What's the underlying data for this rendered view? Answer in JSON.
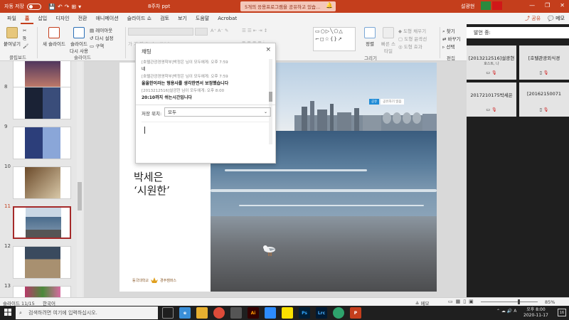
{
  "titlebar": {
    "autosave": "자동 저장",
    "autosave_state": "",
    "doc_title": "8주차 ppt",
    "share_banner": "5개의 응용프로그램을 공유하고 있습...",
    "user": "설광현",
    "controls": [
      "—",
      "❐",
      "✕"
    ]
  },
  "tabs": {
    "items": [
      "파일",
      "홈",
      "삽입",
      "디자인",
      "전환",
      "애니메이션",
      "슬라이드 쇼",
      "검토",
      "보기",
      "도움말",
      "Acrobat"
    ],
    "active_index": 1,
    "share": "공유",
    "memo": "메모"
  },
  "ribbon": {
    "clipboard": {
      "paste": "붙여넣기",
      "label": "클립보드"
    },
    "slides": {
      "new_slide": "새 슬라이드",
      "reuse": "슬라이드 다시 사용",
      "layout": "레이아웃",
      "reset": "다시 설정",
      "section": "구역",
      "label": "슬라이드"
    },
    "drawing": {
      "arrange": "정렬",
      "quick_styles": "빠른 스타일",
      "fill": "도형 채우기",
      "outline": "도형 윤곽선",
      "effects": "도형 효과",
      "label": "그리기"
    },
    "editing": {
      "find": "찾기",
      "replace": "바꾸기",
      "select": "선택",
      "label": "편집"
    }
  },
  "thumbnails": [
    {
      "num": "8"
    },
    {
      "num": "9"
    },
    {
      "num": "10"
    },
    {
      "num": "11",
      "active": true
    },
    {
      "num": "12"
    },
    {
      "num": "13"
    }
  ],
  "chat": {
    "title": "채팅",
    "messages": [
      {
        "meta": "[호텔관광경영학부]박정은 님이 모두에게:     오후 7:59",
        "text": "네"
      },
      {
        "meta": "[호텔관광경영학부]박정은 님이 모두에게:     오후 7:59",
        "text": "울올한이라는 형용사를 생각한면서 보정했습니다"
      },
      {
        "meta": "[2013212516]설광현 님이 모두에게:     오후 8:00",
        "text": "20:10까지 쉬는시간입니다"
      }
    ],
    "save_label": "저장 위치:",
    "save_value": "모두"
  },
  "slide": {
    "title_line1": "박세은",
    "title_line2": "‘시원한’",
    "logo_text": "동국대학교",
    "logo_campus": "경주캠퍼스",
    "chip1": "공유",
    "chip2": "공유하기 일음"
  },
  "attendees": {
    "header": "발언 중:",
    "cards": [
      {
        "name": "[2013212516]설광현",
        "sub": "호스트, 나"
      },
      {
        "name": "[호텔관광외식경",
        "sub": ""
      },
      {
        "name": "2017210175박세은",
        "sub": ""
      },
      {
        "name": "[20162150071",
        "sub": ""
      }
    ]
  },
  "statusbar": {
    "slide_pos": "슬라이드 11/15",
    "language": "한국어",
    "memo": "메모",
    "zoom": "85%"
  },
  "taskbar": {
    "search_placeholder": "검색하려면 여기에 입력하십시오.",
    "apps": [
      {
        "label": "Ai",
        "color": "#330000"
      },
      {
        "label": "Ps",
        "color": "#001e36"
      },
      {
        "label": "Lrc",
        "color": "#001a33"
      },
      {
        "label": "P",
        "color": "#c43e1c"
      }
    ],
    "time": "오후 8:00",
    "date": "2020-11-17",
    "notif": "16"
  }
}
